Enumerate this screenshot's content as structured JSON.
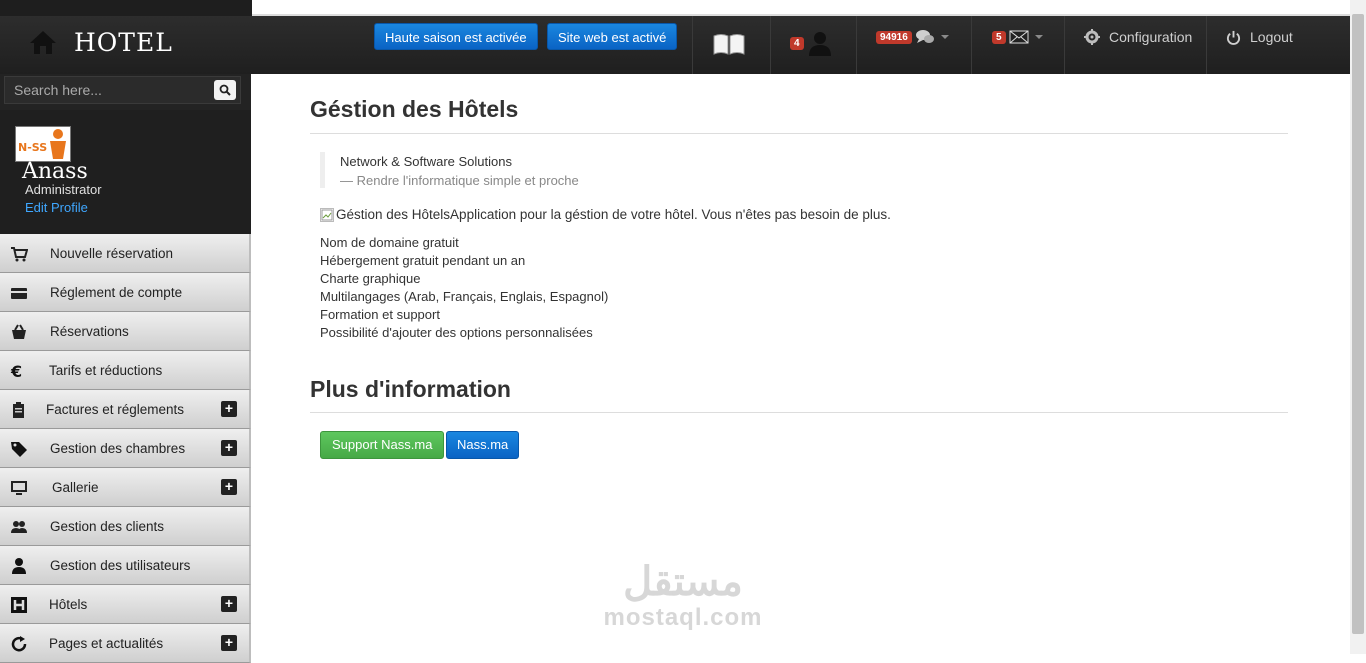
{
  "header": {
    "title": "HOTEL",
    "btn_haute_saison": "Haute saison est activée",
    "btn_site_web": "Site web est activé",
    "users_badge": "4",
    "messages_badge": "94916",
    "mail_badge": "5",
    "configuration": "Configuration",
    "logout": "Logout"
  },
  "sidebar": {
    "search_placeholder": "Search here...",
    "profile": {
      "name": "Anass",
      "role": "Administrator",
      "edit": "Edit Profile",
      "logo_text": "N-SS"
    },
    "items": [
      {
        "label": "Nouvelle réservation",
        "icon": "cart-icon",
        "expandable": false
      },
      {
        "label": "Réglement de compte",
        "icon": "credit-card-icon",
        "expandable": false
      },
      {
        "label": "Réservations",
        "icon": "basket-icon",
        "expandable": false
      },
      {
        "label": "Tarifs et réductions",
        "icon": "euro-icon",
        "expandable": false
      },
      {
        "label": "Factures et réglements",
        "icon": "clipboard-icon",
        "expandable": true
      },
      {
        "label": "Gestion des chambres",
        "icon": "tag-icon",
        "expandable": true
      },
      {
        "label": "Gallerie",
        "icon": "monitor-icon",
        "expandable": true
      },
      {
        "label": "Gestion des clients",
        "icon": "users-icon",
        "expandable": false
      },
      {
        "label": "Gestion des utilisateurs",
        "icon": "user-icon",
        "expandable": false
      },
      {
        "label": "Hôtels",
        "icon": "hotel-icon",
        "expandable": true
      },
      {
        "label": "Pages et actualités",
        "icon": "refresh-icon",
        "expandable": true
      }
    ],
    "plus_symbol": "+"
  },
  "main": {
    "title": "Géstion des Hôtels",
    "quote_line1": "Network & Software Solutions",
    "quote_line2": "— Rendre l'informatique simple et proche",
    "intro": "Géstion des HôtelsApplication pour la géstion de votre hôtel. Vous n'êtes pas besoin de plus.",
    "features": [
      "Nom de domaine gratuit",
      "Hébergement gratuit pendant un an",
      "Charte graphique",
      "Multilangages (Arab, Français, Englais, Espagnol)",
      "Formation et support",
      "Possibilité d'ajouter des options personnalisées"
    ],
    "section2_title": "Plus d'information",
    "btn_support": "Support Nass.ma",
    "btn_nass": "Nass.ma"
  },
  "watermark": {
    "arabic": "مستقل",
    "latin": "mostaql.com"
  },
  "colors": {
    "primary_blue": "#0a63c4",
    "success_green": "#46a946",
    "badge_red": "#c0392b",
    "link_blue": "#3fa7ff"
  }
}
